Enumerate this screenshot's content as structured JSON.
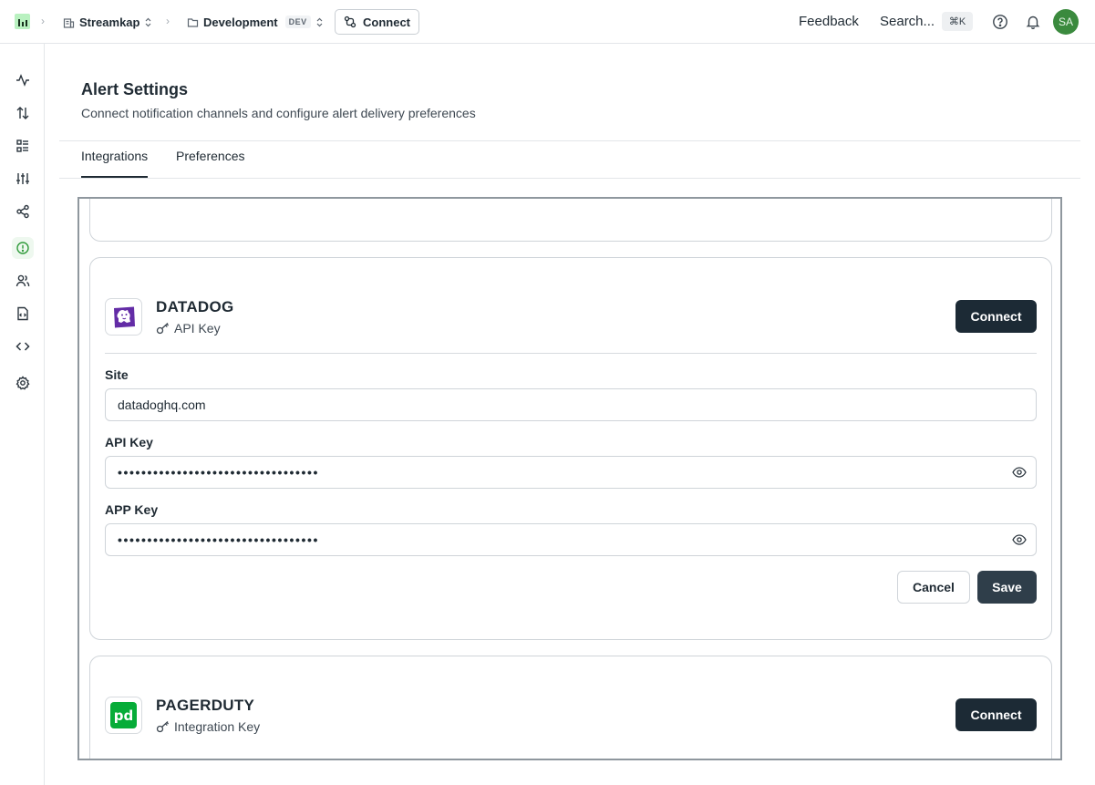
{
  "topbar": {
    "org": "Streamkap",
    "environment": "Development",
    "env_badge": "DEV",
    "connect_label": "Connect",
    "feedback_label": "Feedback",
    "search_label": "Search...",
    "search_shortcut": "⌘K",
    "avatar_initials": "SA"
  },
  "rail": {
    "icons": [
      "activity-icon",
      "transfers-icon",
      "list-icon",
      "sliders-icon",
      "share-icon",
      "alert-icon",
      "users-icon",
      "file-code-icon",
      "code-icon",
      "settings-icon"
    ],
    "active": "alert-icon"
  },
  "page": {
    "title": "Alert Settings",
    "subtitle": "Connect notification channels and configure alert delivery preferences",
    "tabs": [
      {
        "label": "Integrations",
        "active": true
      },
      {
        "label": "Preferences",
        "active": false
      }
    ]
  },
  "integrations": {
    "datadog": {
      "name": "DATADOG",
      "auth_type": "API Key",
      "connect_label": "Connect",
      "fields": {
        "site_label": "Site",
        "site_value": "datadoghq.com",
        "api_key_label": "API Key",
        "api_key_value": "••••••••••••••••••••••••••••••••••",
        "app_key_label": "APP Key",
        "app_key_value": "••••••••••••••••••••••••••••••••••"
      },
      "cancel_label": "Cancel",
      "save_label": "Save"
    },
    "pagerduty": {
      "name": "PAGERDUTY",
      "auth_type": "Integration Key",
      "connect_label": "Connect",
      "logo_text": "pd"
    }
  },
  "colors": {
    "primary_button": "#1c2a35",
    "save_button": "#2f3e4a",
    "brand_green": "#3b8a3e",
    "datadog_purple": "#632ca6",
    "pagerduty_green": "#06ac38"
  }
}
